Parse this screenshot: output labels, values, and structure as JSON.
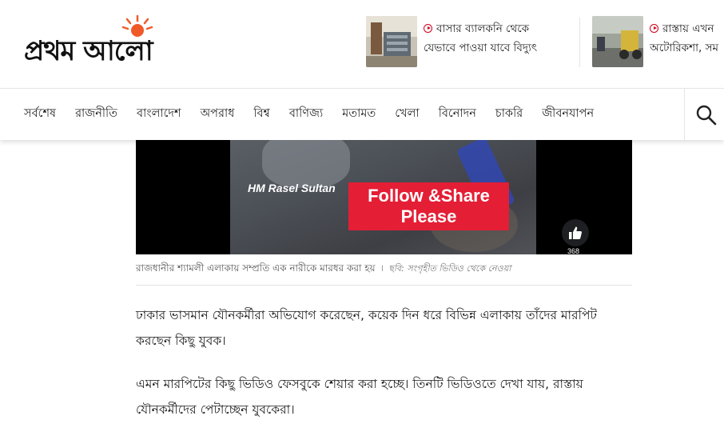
{
  "header": {
    "logo_text": "প্রথম আলো",
    "teasers": [
      {
        "line1": "বাসার ব্যালকনি থেকে",
        "line2": "যেভাবে পাওয়া যাবে বিদ্যুৎ"
      },
      {
        "line1": "রাস্তায় এখন",
        "line2": "অটোরিকশা, সম"
      }
    ]
  },
  "nav": {
    "items": [
      "সর্বশেষ",
      "রাজনীতি",
      "বাংলাদেশ",
      "অপরাধ",
      "বিশ্ব",
      "বাণিজ্য",
      "মতামত",
      "খেলা",
      "বিনোদন",
      "চাকরি",
      "জীবনযাপন"
    ],
    "search_icon": "search-icon"
  },
  "video": {
    "watermark_name": "HM Rasel Sultan",
    "watermark_cta_1": "Follow &Share",
    "watermark_cta_2": "Please",
    "like_icon": "thumbs-up-icon",
    "like_count": "368"
  },
  "caption": {
    "text": "রাজধানীর শ্যামলী এলাকায় সম্প্রতি এক নারীকে মারধর করা হয়",
    "separator": "।",
    "credit": "ছবি: সংগৃহীত ভিডিও থেকে নেওয়া"
  },
  "article": {
    "paragraphs": [
      "ঢাকার ভাসমান যৌনকর্মীরা অভিযোগ করেছেন, কয়েক দিন ধরে বিভিন্ন এলাকায় তাঁদের মারপিট করছেন কিছু যুবক।",
      "এমন মারপিটের কিছু ভিডিও ফেসবুকে শেয়ার করা হচ্ছে। তিনটি ভিডিওতে দেখা যায়, রাস্তায় যৌনকর্মীদের পেটাচ্ছেন যুবকেরা।"
    ]
  },
  "colors": {
    "accent_red": "#e41e35",
    "sun_orange": "#f05a28"
  }
}
